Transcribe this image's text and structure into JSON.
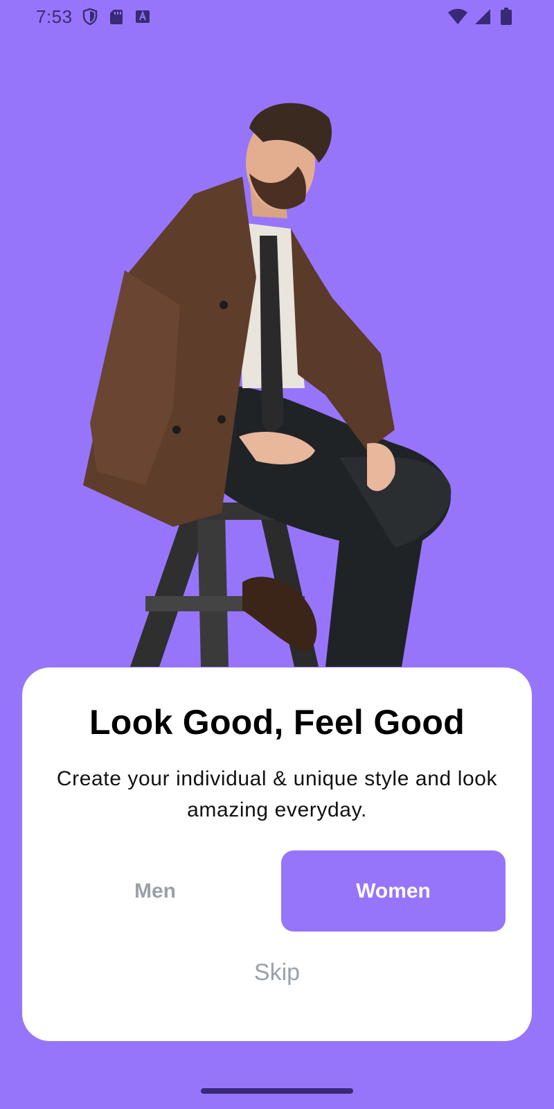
{
  "status_bar": {
    "time": "7:53",
    "left_icons": [
      "shield-icon",
      "sd-card-icon",
      "keyboard-a-icon"
    ],
    "right_icons": [
      "wifi-icon",
      "cellular-signal-icon",
      "battery-icon"
    ]
  },
  "hero": {
    "image": "man-on-stool-illustration"
  },
  "card": {
    "title": "Look Good, Feel Good",
    "subtitle_line1": "Create your individual & unique style and look",
    "subtitle_line2": "amazing everyday.",
    "men_label": "Men",
    "women_label": "Women",
    "skip_label": "Skip",
    "selected": "Women"
  },
  "colors": {
    "background": "#9775FA",
    "accent": "#9775FA",
    "card": "#FFFFFF",
    "muted_text": "#9AA1A8"
  }
}
